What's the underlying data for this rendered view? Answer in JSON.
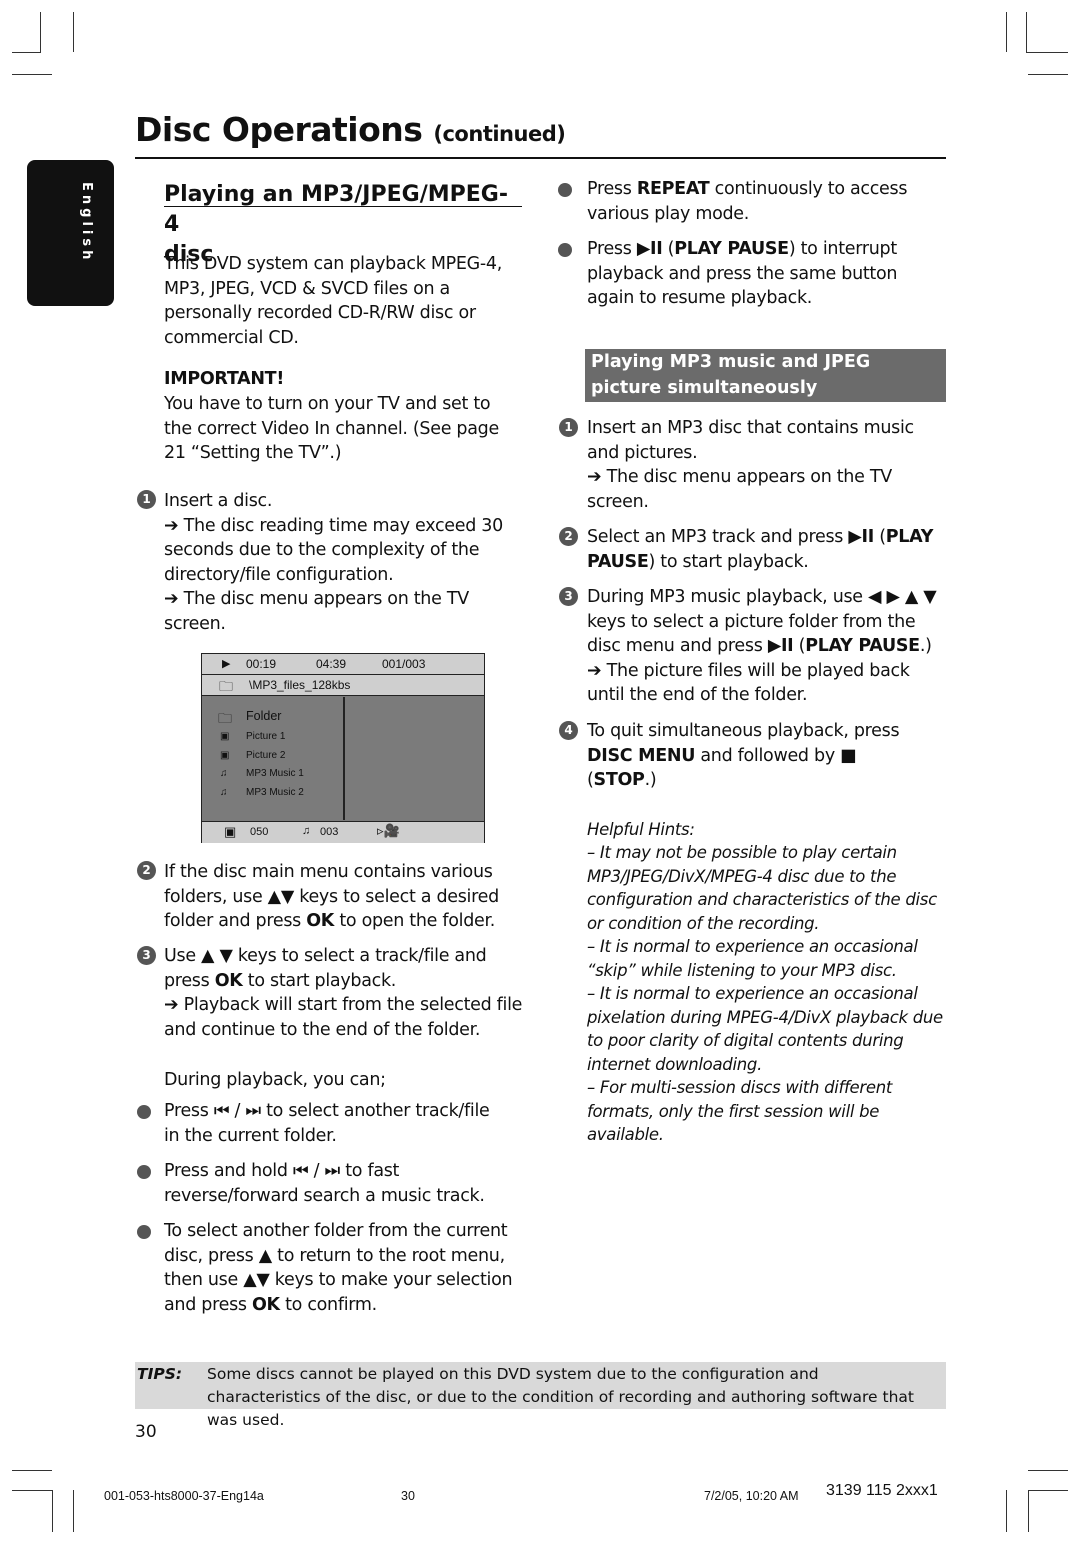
{
  "header": {
    "title": "Disc Operations",
    "continued": "(continued)",
    "language_tab": "English"
  },
  "left": {
    "heading_line1": "Playing an MP3/JPEG/MPEG-4",
    "heading_line2": "disc",
    "intro": [
      [
        "This DVD system can playback MPEG-4, MP3, JPEG, VCD & SVCD files on a personally recorded CD-R/RW disc or commercial CD."
      ]
    ],
    "important_label": "IMPORTANT!",
    "important_text": [
      [
        "You have to turn on your TV and set to the correct Video In channel.  (See page 21 “Setting the TV”.)"
      ]
    ],
    "steps": [
      {
        "num": "1",
        "text": [
          [
            "Insert a disc."
          ],
          [
            "➔ ",
            "The disc reading time may exceed 30 seconds due to the complexity of the directory/file configuration."
          ],
          [
            "➔ ",
            "The disc menu appears on the TV screen."
          ]
        ]
      },
      {
        "num": "2",
        "text": [
          [
            "If the disc main menu contains various folders, use ▲▼ keys to select a desired folder and press ",
            {
              "b": "OK"
            },
            " to open the folder."
          ]
        ]
      },
      {
        "num": "3",
        "text": [
          [
            "Use ▲ ▼ keys to select a track/file and press ",
            {
              "b": "OK"
            },
            " to start playback."
          ],
          [
            "➔ ",
            "Playback will start from the selected file and continue to the end of the folder."
          ]
        ]
      }
    ],
    "during": "During playback, you can;",
    "bullets": [
      [
        [
          "Press ⏮ / ⏭ to select another track/file in the current folder."
        ]
      ],
      [
        [
          "Press and hold ⏮ / ⏭ to fast reverse/forward search a music track."
        ]
      ],
      [
        [
          "To select another folder from the current disc, press ▲ to return to the root menu, then use ▲▼ keys to make your selection and press ",
          {
            "b": "OK"
          },
          " to confirm."
        ]
      ]
    ],
    "screen": {
      "elapsed": "00:19",
      "total": "04:39",
      "track": "001/003",
      "path": "\\MP3_files_128kbs",
      "items": [
        {
          "label": "Folder",
          "icon": "folder-icon"
        },
        {
          "label": "Picture 1",
          "icon": "picture-icon"
        },
        {
          "label": "Picture 2",
          "icon": "picture-icon"
        },
        {
          "label": "MP3 Music 1",
          "icon": "music-note-icon"
        },
        {
          "label": "MP3 Music 2",
          "icon": "music-note-icon"
        }
      ],
      "picture_count": "050",
      "music_count": "003"
    }
  },
  "right": {
    "bullets": [
      [
        [
          "Press ",
          {
            "b": "REPEAT"
          },
          " continuously to access various play mode."
        ]
      ],
      [
        [
          "Press ",
          {
            "b": "▶II"
          },
          " (",
          {
            "b": "PLAY PAUSE"
          },
          ") to interrupt playback and press the same button again to resume playback."
        ]
      ]
    ],
    "subheading_line1": "Playing MP3 music and JPEG",
    "subheading_line2": "picture simultaneously",
    "steps": [
      {
        "num": "1",
        "text": [
          [
            "Insert an MP3 disc that contains music and pictures."
          ],
          [
            "➔ ",
            "The disc menu appears on the TV screen."
          ]
        ]
      },
      {
        "num": "2",
        "text": [
          [
            "Select an MP3 track and press ",
            {
              "b": "▶II"
            },
            " (",
            {
              "b": "PLAY PAUSE"
            },
            ") to start playback."
          ]
        ]
      },
      {
        "num": "3",
        "text": [
          [
            "During MP3 music playback, use ◀ ▶ ▲ ▼ keys to select a picture folder from the disc menu and press ",
            {
              "b": "▶II"
            },
            " (",
            {
              "b": "PLAY PAUSE"
            },
            ".)"
          ],
          [
            "➔ ",
            "The picture files will be played back until the end of the folder."
          ]
        ]
      },
      {
        "num": "4",
        "text": [
          [
            "To quit simultaneous playback, press ",
            {
              "b": "DISC MENU"
            },
            " and followed by ",
            {
              "b": "■"
            },
            " (",
            {
              "b": "STOP"
            },
            ".)"
          ]
        ]
      }
    ],
    "hints_title": "Helpful Hints:",
    "hints": [
      "–  It may not be possible to play certain MP3/JPEG/DivX/MPEG-4 disc due to the configuration and characteristics of the disc or condition of the recording.",
      "–  It is normal to experience an occasional “skip” while listening to your MP3 disc.",
      "–  It is normal to experience an occasional pixelation during MPEG-4/DivX playback due to poor clarity of digital contents during internet downloading.",
      "–  For multi-session discs with different formats, only the first session will be available."
    ]
  },
  "tips": {
    "label": "TIPS:",
    "text": "Some discs cannot be played on this DVD system due to the configuration and characteristics of the disc, or due to the condition of recording and authoring software that was used."
  },
  "page_number": "30",
  "footer": {
    "file": "001-053-hts8000-37-Eng14a",
    "page": "30",
    "datetime": "7/2/05, 10:20 AM",
    "code": "3139 115 2xxx1"
  }
}
